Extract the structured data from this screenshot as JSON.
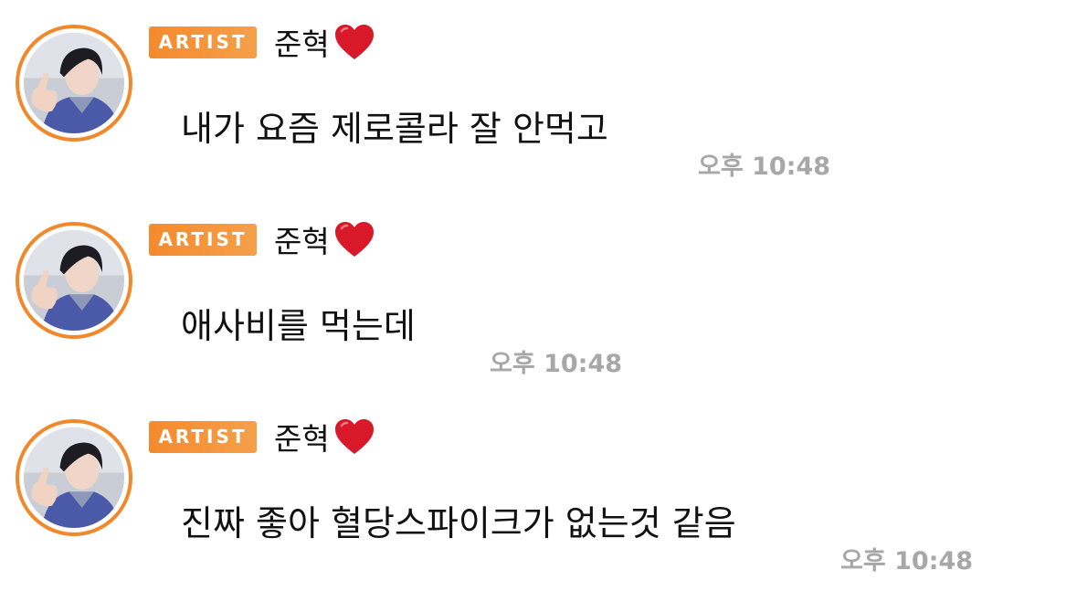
{
  "messages": [
    {
      "badge": "ARTIST",
      "sender": "준혁",
      "sender_icon": "red-heart-icon",
      "text": "내가 요즘 제로콜라 잘 안먹고",
      "time": "오후 10:48"
    },
    {
      "badge": "ARTIST",
      "sender": "준혁",
      "sender_icon": "red-heart-icon",
      "text": "애사비를 먹는데",
      "time": "오후 10:48"
    },
    {
      "badge": "ARTIST",
      "sender": "준혁",
      "sender_icon": "red-heart-icon",
      "text": "진짜 좋아 혈당스파이크가 없는것 같음",
      "time": "오후 10:48"
    }
  ],
  "colors": {
    "badge_gradient_start": "#f58a2d",
    "badge_gradient_end": "#f5a04a",
    "avatar_ring": "#f2882c",
    "time_text": "#a7a7a7",
    "heart": "#d8192a"
  }
}
